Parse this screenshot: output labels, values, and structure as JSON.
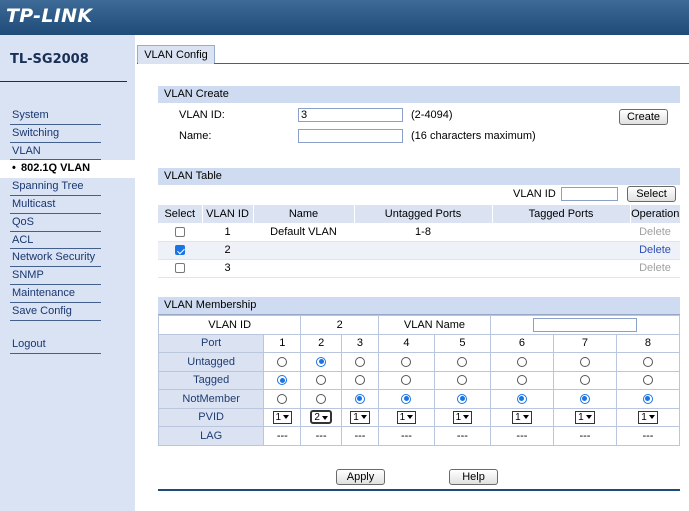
{
  "brand": {
    "logo": "TP-LINK",
    "model": "TL-SG2008"
  },
  "sidebar": {
    "items": [
      {
        "label": "System",
        "active": false
      },
      {
        "label": "Switching",
        "active": false
      },
      {
        "label": "VLAN",
        "active": false
      },
      {
        "label": "802.1Q VLAN",
        "active": true,
        "bullet": "•"
      },
      {
        "label": "Spanning Tree",
        "active": false
      },
      {
        "label": "Multicast",
        "active": false
      },
      {
        "label": "QoS",
        "active": false
      },
      {
        "label": "ACL",
        "active": false
      },
      {
        "label": "Network Security",
        "active": false
      },
      {
        "label": "SNMP",
        "active": false
      },
      {
        "label": "Maintenance",
        "active": false
      },
      {
        "label": "Save Config",
        "active": false
      }
    ],
    "logout": "Logout"
  },
  "tab": {
    "label": "VLAN Config"
  },
  "create": {
    "title": "VLAN Create",
    "vlan_id_label": "VLAN ID:",
    "vlan_id_value": "3",
    "vlan_id_hint": "(2-4094)",
    "name_label": "Name:",
    "name_value": "",
    "name_hint": "(16 characters maximum)",
    "create_button": "Create"
  },
  "vlan_table": {
    "title": "VLAN Table",
    "search_label": "VLAN ID",
    "search_value": "",
    "select_button": "Select",
    "columns": [
      "Select",
      "VLAN ID",
      "Name",
      "Untagged Ports",
      "Tagged Ports",
      "Operation"
    ],
    "rows": [
      {
        "checked": false,
        "vlan_id": "1",
        "name": "Default VLAN",
        "untagged": "1-8",
        "tagged": "",
        "operation": "Delete",
        "op_active": false
      },
      {
        "checked": true,
        "vlan_id": "2",
        "name": "",
        "untagged": "",
        "tagged": "",
        "operation": "Delete",
        "op_active": true
      },
      {
        "checked": false,
        "vlan_id": "3",
        "name": "",
        "untagged": "",
        "tagged": "",
        "operation": "Delete",
        "op_active": false
      }
    ]
  },
  "membership": {
    "title": "VLAN Membership",
    "vlan_id_label": "VLAN ID",
    "vlan_id_value": "2",
    "vlan_name_label": "VLAN Name",
    "vlan_name_value": "",
    "port_label": "Port",
    "ports": [
      "1",
      "2",
      "3",
      "4",
      "5",
      "6",
      "7",
      "8"
    ],
    "row_labels": {
      "untagged": "Untagged",
      "tagged": "Tagged",
      "notmember": "NotMember",
      "pvid": "PVID",
      "lag": "LAG"
    },
    "selection": [
      "tagged",
      "untagged",
      "notmember",
      "notmember",
      "notmember",
      "notmember",
      "notmember",
      "notmember"
    ],
    "pvid": [
      "1",
      "2",
      "1",
      "1",
      "1",
      "1",
      "1",
      "1"
    ],
    "lag": [
      "---",
      "---",
      "---",
      "---",
      "---",
      "---",
      "---",
      "---"
    ]
  },
  "footer": {
    "apply_button": "Apply",
    "help_button": "Help"
  },
  "colors": {
    "header": "#1f4b78",
    "sidebar_bg": "#d9e3f4",
    "panel_head": "#cfdbf0",
    "accent": "#1b74e4"
  }
}
